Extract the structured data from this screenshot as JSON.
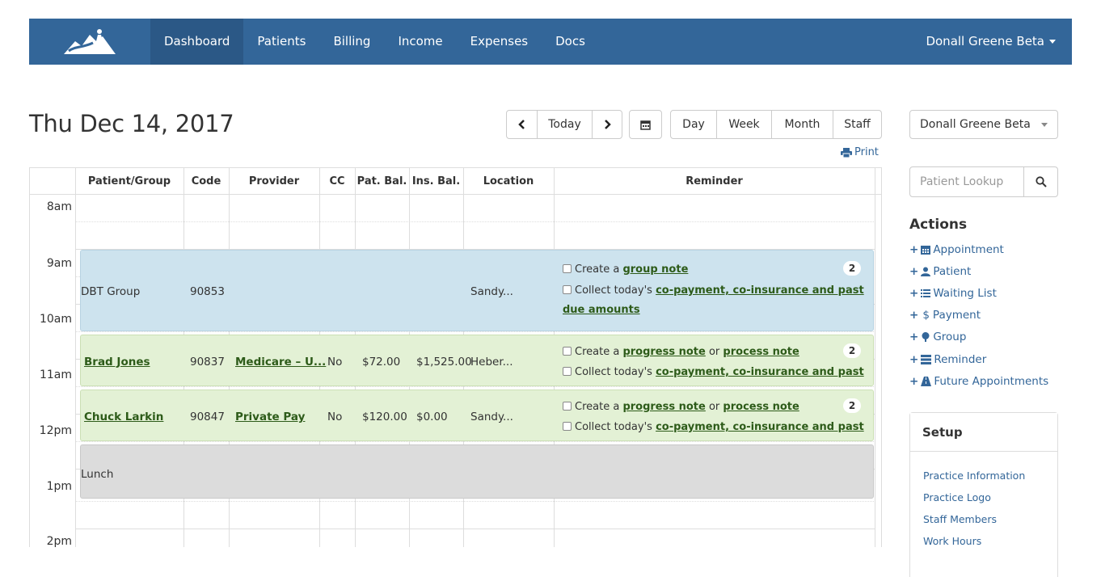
{
  "nav": {
    "items": [
      "Dashboard",
      "Patients",
      "Billing",
      "Income",
      "Expenses",
      "Docs"
    ],
    "active": "Dashboard",
    "user": "Donall Greene Beta"
  },
  "header": {
    "date": "Thu Dec 14, 2017",
    "today": "Today",
    "views": [
      "Day",
      "Week",
      "Month",
      "Staff"
    ],
    "print": "Print"
  },
  "table": {
    "columns": [
      "Patient/Group",
      "Code",
      "Provider",
      "CC",
      "Pat. Bal.",
      "Ins. Bal.",
      "Location",
      "Reminder"
    ],
    "times": [
      "8am",
      "9am",
      "10am",
      "11am",
      "12pm",
      "1pm",
      "2pm"
    ]
  },
  "appointments": [
    {
      "patient": "DBT Group",
      "code": "90853",
      "provider": "",
      "cc": "",
      "pat_bal": "",
      "ins_bal": "",
      "location": "Sandy...",
      "reminder1_pre": "Create a ",
      "reminder1_link": "group note",
      "reminder1_mid": "",
      "reminder1_link2": "",
      "reminder2_pre": "Collect today's ",
      "reminder2_link": "co-payment, co-insurance and past",
      "reminder2_cont": "due amounts",
      "badge": "2"
    },
    {
      "patient": "Brad Jones",
      "code": "90837",
      "provider": "Medicare – U...",
      "cc": "No",
      "pat_bal": "$72.00",
      "ins_bal": "$1,525.00",
      "location": "Heber...",
      "reminder1_pre": "Create a ",
      "reminder1_link": "progress note",
      "reminder1_mid": " or ",
      "reminder1_link2": "process note",
      "reminder2_pre": "Collect today's ",
      "reminder2_link": "co-payment, co-insurance and past",
      "badge": "2"
    },
    {
      "patient": "Chuck Larkin",
      "code": "90847",
      "provider": "Private Pay",
      "cc": "No",
      "pat_bal": "$120.00",
      "ins_bal": "$0.00",
      "location": "Sandy...",
      "reminder1_pre": "Create a ",
      "reminder1_link": "progress note",
      "reminder1_mid": " or ",
      "reminder1_link2": "process note",
      "reminder2_pre": "Collect today's ",
      "reminder2_link": "co-payment, co-insurance and past",
      "badge": "2"
    }
  ],
  "lunch": "Lunch",
  "sidebar": {
    "staff_select": "Donall Greene Beta",
    "lookup_placeholder": "Patient Lookup",
    "actions_title": "Actions",
    "actions": [
      "Appointment",
      "Patient",
      "Waiting List",
      "Payment",
      "Group",
      "Reminder",
      "Future Appointments"
    ],
    "payment_symbol": "$",
    "setup_title": "Setup",
    "setup_links": [
      "Practice Information",
      "Practice Logo",
      "Staff Members",
      "Work Hours"
    ]
  },
  "colors": {
    "nav": "#336699",
    "nav_active": "#2b5886",
    "group_appt": "#cde3ee",
    "patient_appt": "#e3f1d5",
    "lunch": "#dcdcdc",
    "link_green": "#2d5b19"
  }
}
